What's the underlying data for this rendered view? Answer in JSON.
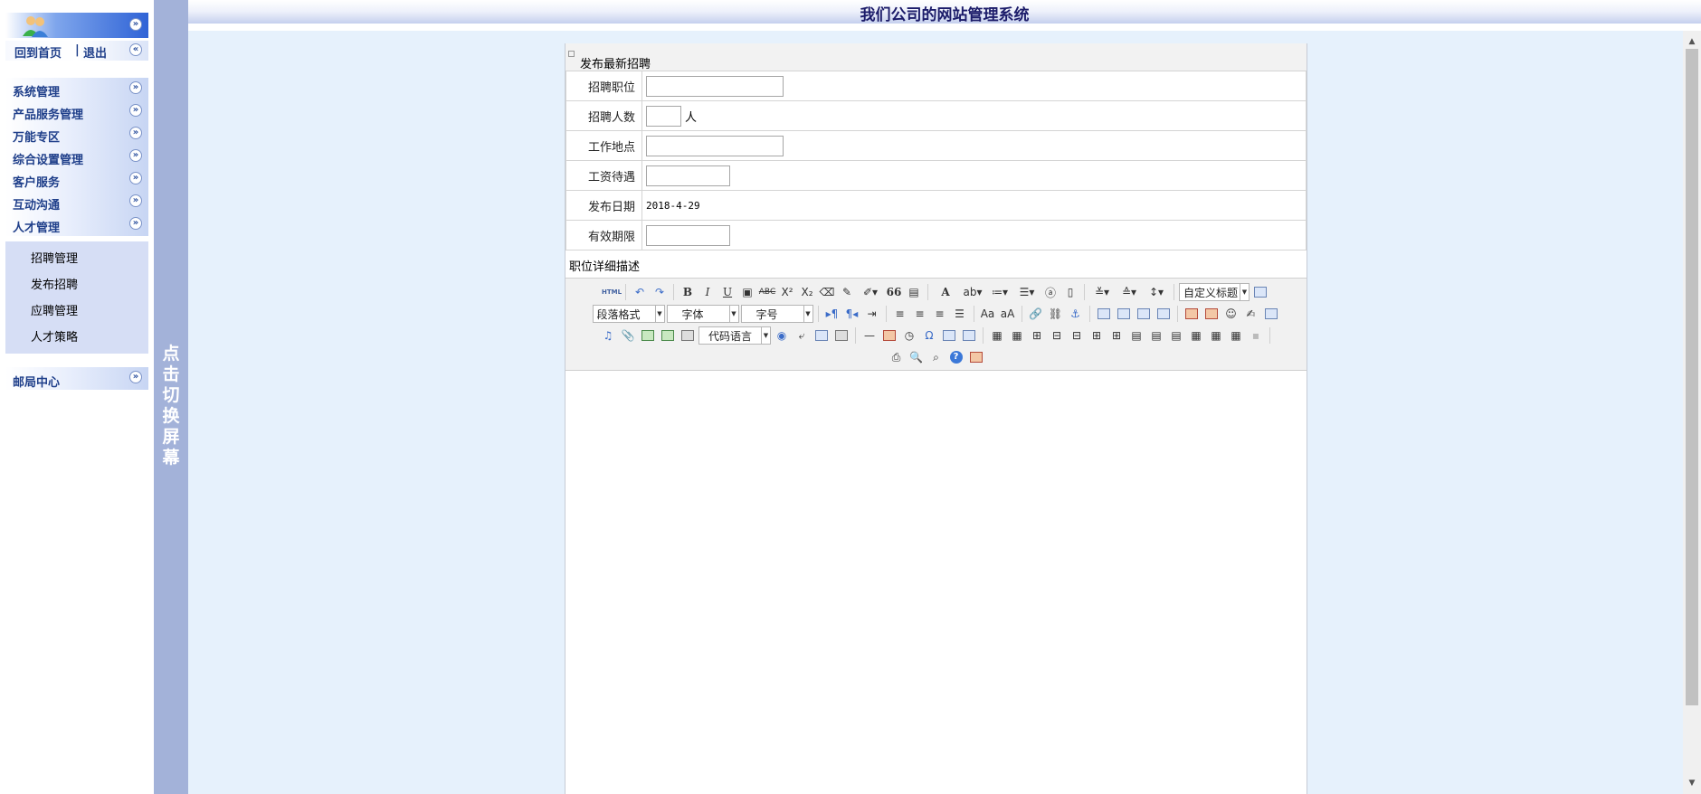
{
  "header": {
    "title": "我们公司的网站管理系统"
  },
  "sidebar": {
    "links": {
      "home": "回到首页",
      "separator": "|",
      "logout": "退出"
    },
    "menu": [
      {
        "label": "系统管理"
      },
      {
        "label": "产品服务管理"
      },
      {
        "label": "万能专区"
      },
      {
        "label": "综合设置管理"
      },
      {
        "label": "客户服务"
      },
      {
        "label": "互动沟通"
      },
      {
        "label": "人才管理"
      }
    ],
    "submenu": [
      {
        "label": "招聘管理"
      },
      {
        "label": "发布招聘"
      },
      {
        "label": "应聘管理"
      },
      {
        "label": "人才策略"
      }
    ],
    "mail": {
      "label": "邮局中心"
    },
    "collapse_glyph": "«",
    "expand_glyph": "»"
  },
  "toggle_bar": {
    "text": "点击切换屏幕"
  },
  "form": {
    "caption": "发布最新招聘",
    "fields": [
      {
        "label": "招聘职位",
        "value": ""
      },
      {
        "label": "招聘人数",
        "value": "",
        "unit": "人"
      },
      {
        "label": "工作地点",
        "value": ""
      },
      {
        "label": "工资待遇",
        "value": ""
      },
      {
        "label": "发布日期",
        "value": "2018-4-29"
      },
      {
        "label": "有效期限",
        "value": ""
      }
    ],
    "description_label": "职位详细描述"
  },
  "editor": {
    "html_label": "HTML",
    "bold": "B",
    "italic": "I",
    "underline": "U",
    "strike": "ABC",
    "superscript": "X²",
    "subscript": "X₂",
    "quote": "66",
    "font_color": "A",
    "custom_heading": "自定义标题",
    "paragraph_format": "段落格式",
    "font_family": "字体",
    "font_size": "字号",
    "code_language": "代码语言",
    "omega": "Ω",
    "help": "?",
    "dropdown_arrow": "▾",
    "select_arrow": "▼"
  },
  "scrollbar": {
    "up": "▲",
    "down": "▼"
  }
}
